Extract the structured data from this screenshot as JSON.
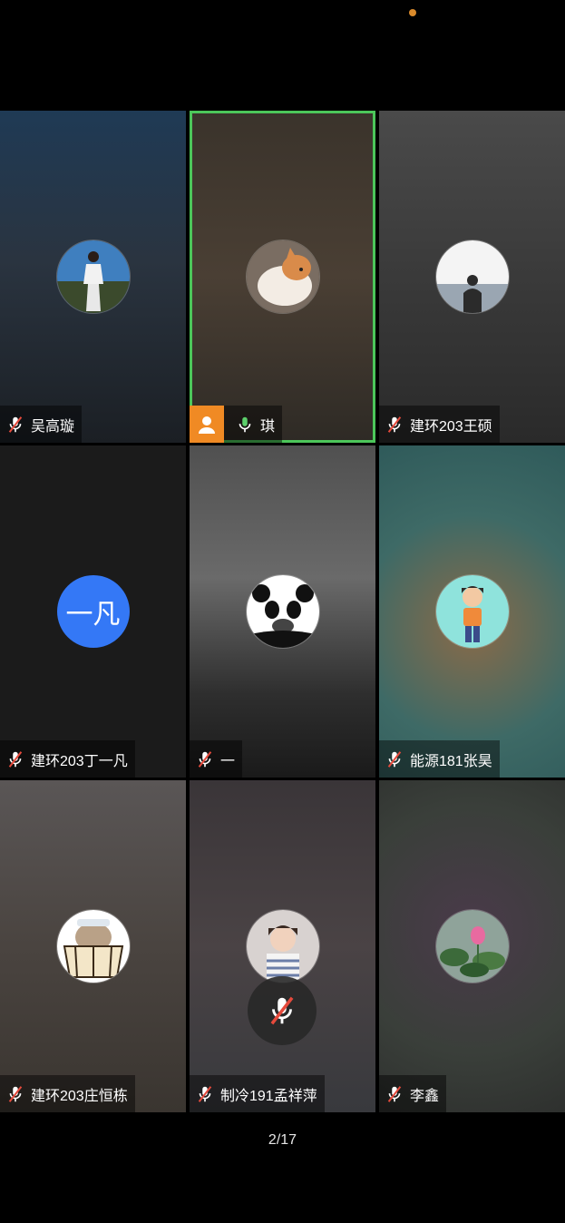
{
  "meeting": {
    "page_indicator": "2/17",
    "tiles": [
      {
        "name": "吴高璇",
        "mic": "muted",
        "avatar": "photo-woman-white-dress-icon"
      },
      {
        "name": "琪",
        "mic": "on",
        "host": true,
        "active_speaker": true,
        "avatar": "photo-cat-icon"
      },
      {
        "name": "建环203王硕",
        "mic": "muted",
        "avatar": "photo-silhouette-mountains-icon"
      },
      {
        "name": "建环203丁一凡",
        "mic": "muted",
        "avatar_initials": "一凡"
      },
      {
        "name": "一",
        "mic": "muted",
        "avatar": "panda-meme-icon"
      },
      {
        "name": "能源181张昊",
        "mic": "muted",
        "avatar": "cartoon-boy-icon"
      },
      {
        "name": "建环203庄恒栋",
        "mic": "muted",
        "avatar": "cartoon-cat-in-tub-icon"
      },
      {
        "name": "制冷191孟祥萍",
        "mic": "muted",
        "avatar": "photo-child-icon"
      },
      {
        "name": "李鑫",
        "mic": "muted",
        "avatar": "photo-lotus-icon"
      }
    ]
  },
  "colors": {
    "active_border": "#4cc65a",
    "host_badge": "#f08a24",
    "initials_avatar": "#3478f6",
    "mute_slash": "#e64a3c",
    "mic_on": "#5ccf6b"
  }
}
